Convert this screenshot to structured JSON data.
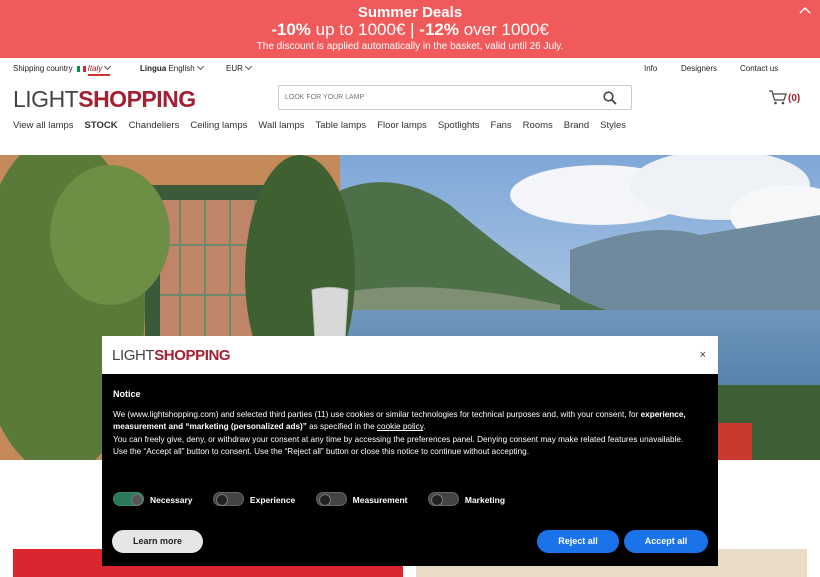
{
  "promo": {
    "title": "Summer Deals",
    "deal_a_pct": "-10%",
    "deal_a_text": " up to 1000€ | ",
    "deal_b_pct": "-12%",
    "deal_b_text": " over 1000€",
    "note": "The discount is applied automatically in the basket, valid until 26 July."
  },
  "topbar": {
    "shipping_label": "Shipping country",
    "shipping_value": "Italy",
    "lingua_label": "Lingua",
    "lingua_value": "English",
    "currency": "EUR",
    "info": "Info",
    "designers": "Designers",
    "contact": "Contact us"
  },
  "logo": {
    "part1": "LIGHT",
    "part2": "SHOPPING"
  },
  "search": {
    "placeholder": "LOOK FOR YOUR LAMP"
  },
  "cart": {
    "count": "(0)"
  },
  "nav": {
    "items": [
      "View all lamps",
      "STOCK",
      "Chandeliers",
      "Ceiling lamps",
      "Wall lamps",
      "Table lamps",
      "Floor lamps",
      "Spotlights",
      "Fans",
      "Rooms",
      "Brand",
      "Styles"
    ]
  },
  "consent": {
    "logo_part1": "LIGHT",
    "logo_part2": "SHOPPING",
    "close": "×",
    "title": "Notice",
    "p1_a": "We (www.lightshopping.com) and selected third parties (11) use cookies or similar technologies for technical purposes and, with your consent, for ",
    "p1_b": "experience, measurement and “marketing (personalized ads)”",
    "p1_c": " as specified in the ",
    "p1_link": "cookie policy",
    "p1_d": ".",
    "p2": "You can freely give, deny, or withdraw your consent at any time by accessing the preferences panel. Denying consent may make related features unavailable.",
    "p3": "Use the “Accept all” button to consent. Use the “Reject all” button or close this notice to continue without accepting.",
    "toggles": [
      "Necessary",
      "Experience",
      "Measurement",
      "Marketing"
    ],
    "learn_more": "Learn more",
    "reject_all": "Reject all",
    "accept_all": "Accept all"
  },
  "colors": {
    "promo_bg": "#f05a5a",
    "brand": "#a32032",
    "button_blue": "#1a73e8"
  }
}
